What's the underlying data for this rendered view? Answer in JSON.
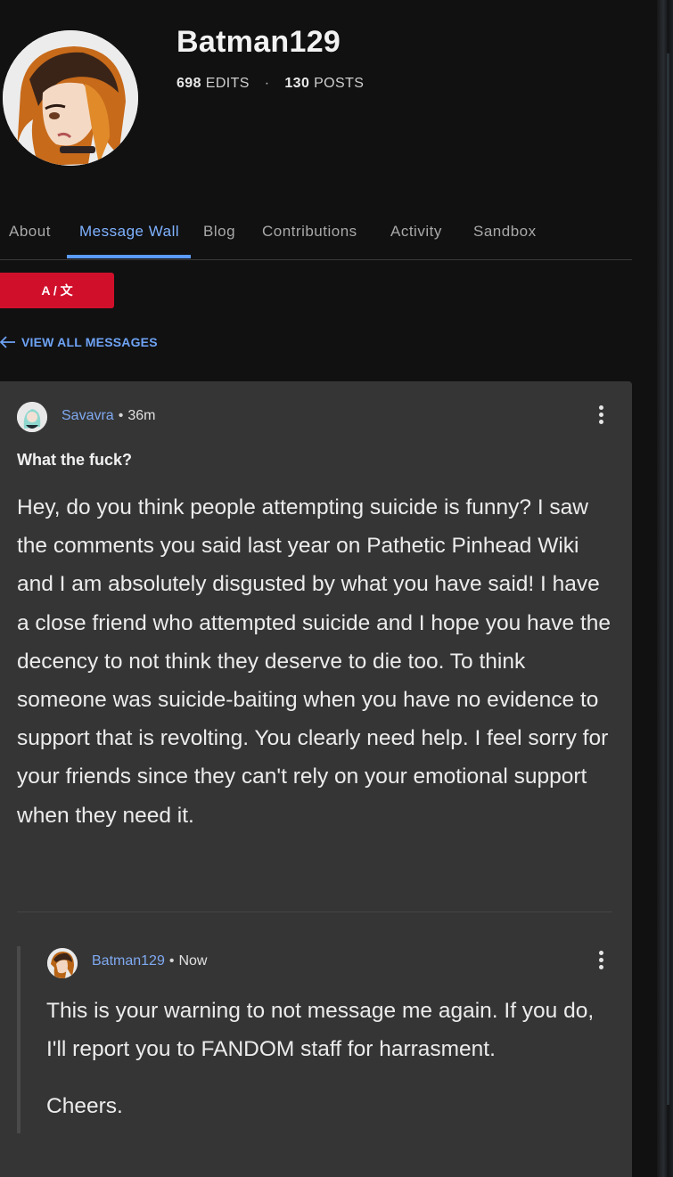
{
  "profile": {
    "username": "Batman129",
    "edits_count": "698",
    "edits_label": "EDITS",
    "posts_count": "130",
    "posts_label": "POSTS",
    "separator": "·"
  },
  "tabs": [
    {
      "label": "About",
      "active": false
    },
    {
      "label": "Message Wall",
      "active": true
    },
    {
      "label": "Blog",
      "active": false
    },
    {
      "label": "Contributions",
      "active": false
    },
    {
      "label": "Activity",
      "active": false
    },
    {
      "label": "Sandbox",
      "active": false
    }
  ],
  "translate_button": {
    "label": "A / 文"
  },
  "nav": {
    "view_all_label": "VIEW ALL MESSAGES"
  },
  "message": {
    "author": "Savavra",
    "separator": "•",
    "time": "36m",
    "subject": "What the fuck?",
    "body": "Hey, do you think people attempting suicide is funny? I saw the comments you said last year on Pathetic Pinhead Wiki and I am absolutely disgusted by what you have said! I have a close friend who attempted suicide and I hope you have the decency to not think they deserve to die too. To think someone was suicide-baiting when you have no evidence to support that is revolting. You clearly need help. I feel sorry for your friends since they can't rely on your emotional support when they need it."
  },
  "reply": {
    "author": "Batman129",
    "separator": "•",
    "time": "Now",
    "body": "This is your warning to not message me again. If you do, I'll report you to FANDOM staff for harrasment.",
    "signoff": "Cheers."
  },
  "colors": {
    "background": "#111112",
    "card": "#353535",
    "accent_blue": "#5b9bff",
    "link_blue": "#7fa9f0",
    "translate_red": "#d0102b"
  }
}
